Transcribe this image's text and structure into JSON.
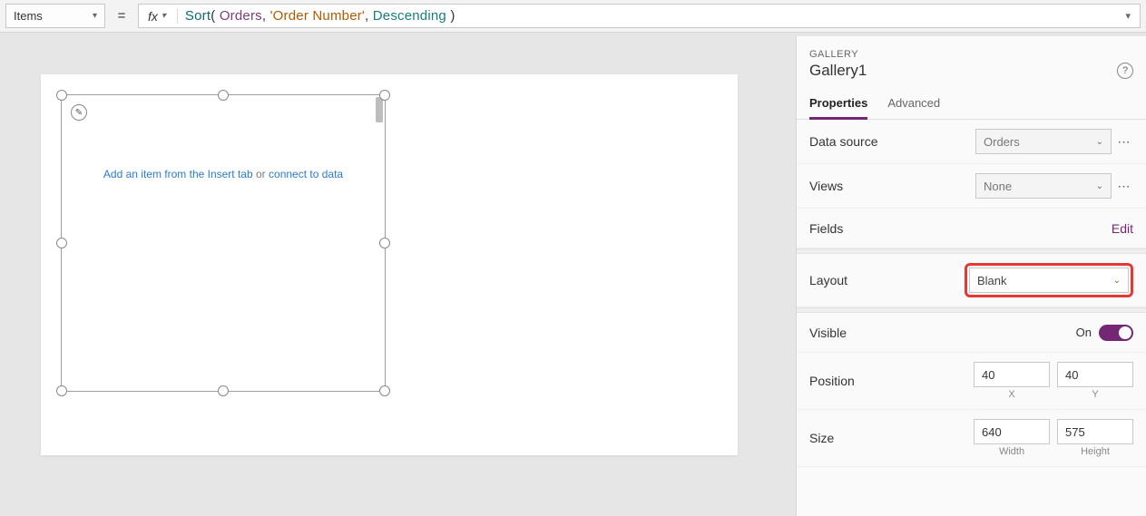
{
  "formulaBar": {
    "property": "Items",
    "fxLabel": "fx",
    "formula": {
      "func": "Sort",
      "ident": "Orders",
      "str": "'Order Number'",
      "enum": "Descending"
    },
    "equals": "="
  },
  "canvas": {
    "galleryHintLink1": "Add an item from the Insert tab",
    "galleryHintPlain": "or",
    "galleryHintLink2": "connect to data"
  },
  "rightPane": {
    "heading": "GALLERY",
    "name": "Gallery1",
    "tabs": {
      "properties": "Properties",
      "advanced": "Advanced"
    },
    "dataSource": {
      "label": "Data source",
      "value": "Orders"
    },
    "views": {
      "label": "Views",
      "value": "None"
    },
    "fields": {
      "label": "Fields",
      "edit": "Edit"
    },
    "layout": {
      "label": "Layout",
      "value": "Blank"
    },
    "visible": {
      "label": "Visible",
      "state": "On"
    },
    "position": {
      "label": "Position",
      "x": "40",
      "y": "40",
      "xLabel": "X",
      "yLabel": "Y"
    },
    "size": {
      "label": "Size",
      "w": "640",
      "h": "575",
      "wLabel": "Width",
      "hLabel": "Height"
    }
  }
}
